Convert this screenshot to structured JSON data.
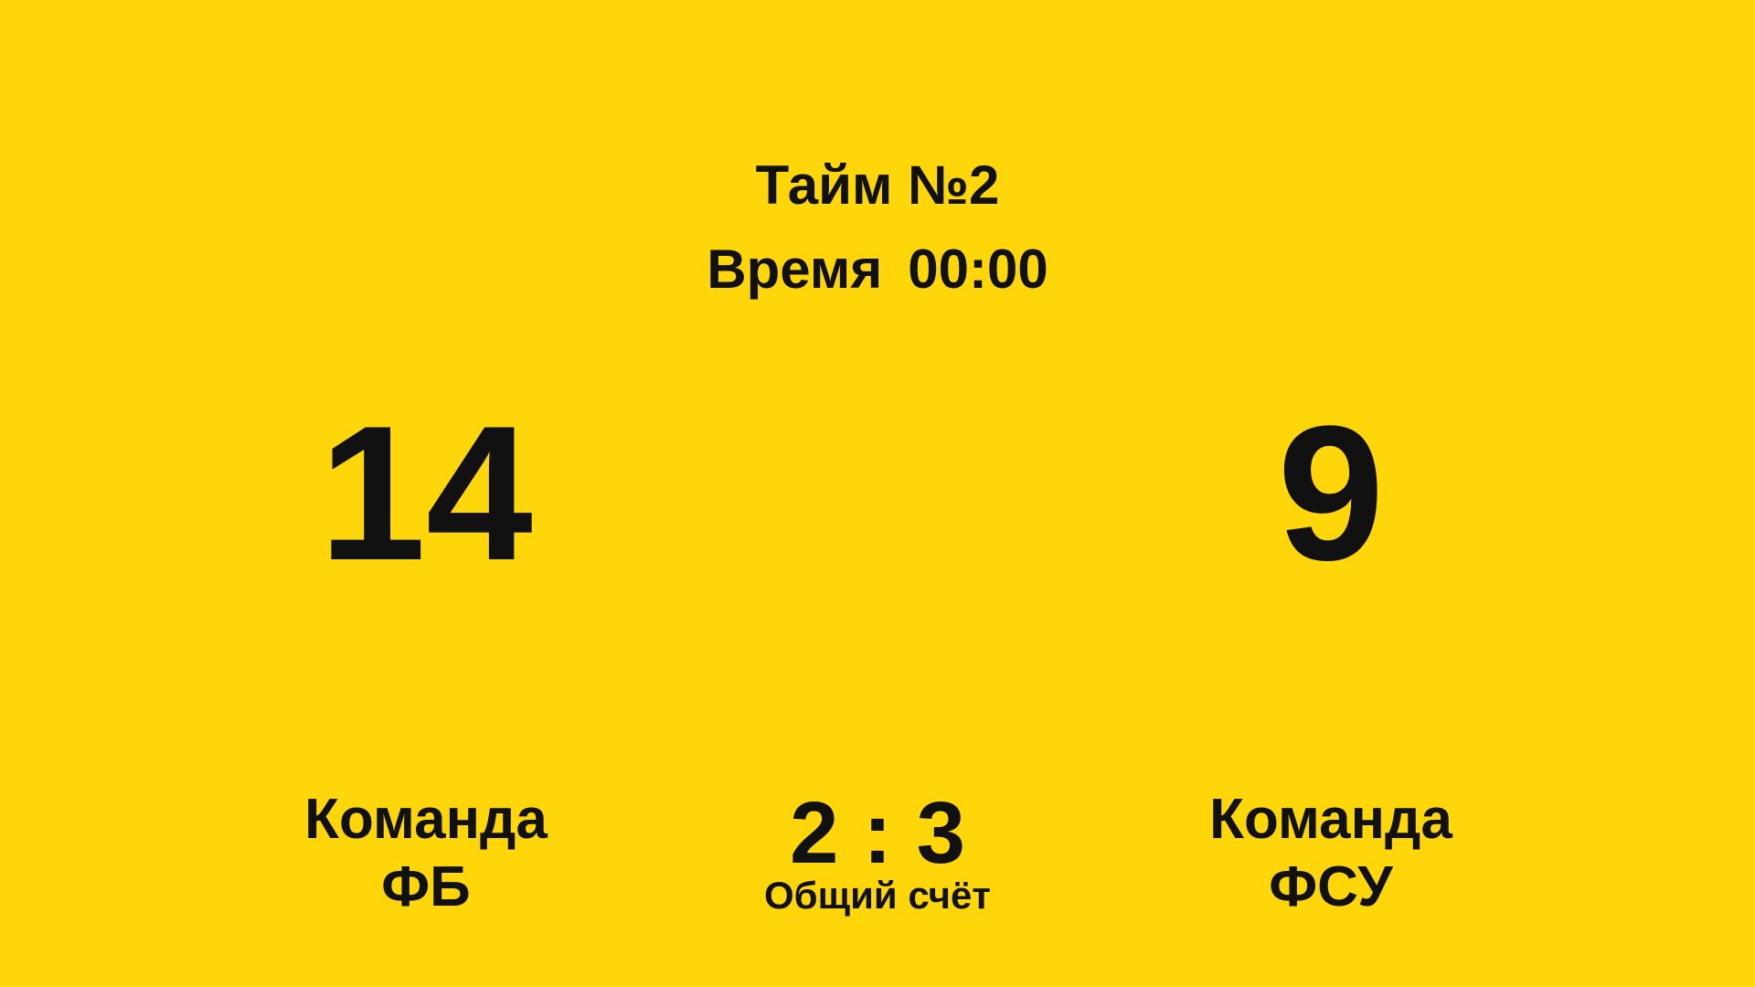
{
  "period": {
    "label": "Тайм №2"
  },
  "timer": {
    "label": "Время",
    "value": "00:00"
  },
  "left_team": {
    "score": "14",
    "name_line1": "Команда",
    "name_line2": "ФБ"
  },
  "right_team": {
    "score": "9",
    "name_line1": "Команда",
    "name_line2": "ФСУ"
  },
  "total": {
    "score": "2 : 3",
    "label": "Общий счёт"
  },
  "colors": {
    "background": "#FFD60A",
    "text": "#111111"
  }
}
